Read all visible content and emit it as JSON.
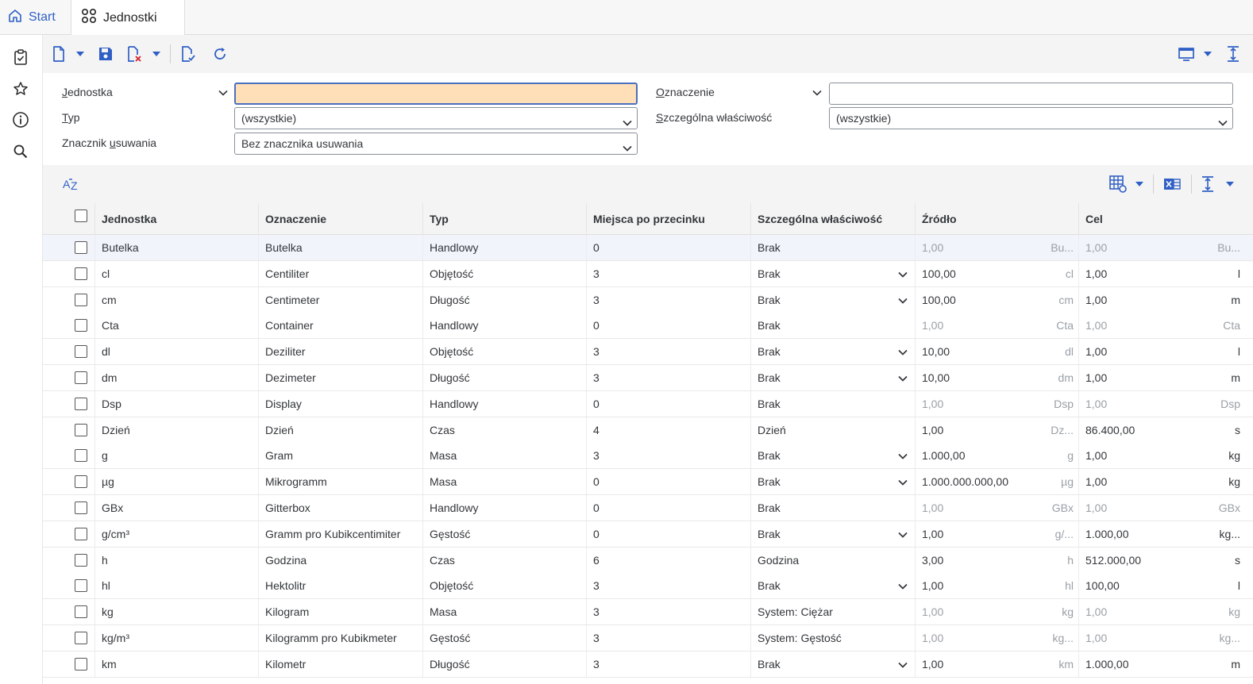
{
  "tabs": [
    {
      "label": "Start",
      "icon": "home-icon"
    },
    {
      "label": "Jednostki",
      "icon": "apps-grid-icon"
    }
  ],
  "rail": [
    "clipboard-check-icon",
    "star-icon",
    "info-icon",
    "search-icon"
  ],
  "filters": {
    "jednostka": {
      "label_pre": "",
      "label_u": "J",
      "label_post": "ednostka",
      "value": ""
    },
    "oznaczenie": {
      "label_pre": "",
      "label_u": "O",
      "label_post": "znaczenie",
      "value": ""
    },
    "typ": {
      "label_pre": "",
      "label_u": "T",
      "label_post": "yp",
      "value": "(wszystkie)"
    },
    "szczegolna": {
      "label_pre": "",
      "label_u": "S",
      "label_post": "zczególna właściwość",
      "value": "(wszystkie)"
    },
    "znacznik": {
      "label_pre": "Znacznik ",
      "label_u": "u",
      "label_post": "suwania",
      "value": "Bez znacznika usuwania"
    }
  },
  "table": {
    "headers": [
      "Jednostka",
      "Oznaczenie",
      "Typ",
      "Miejsca po przecinku",
      "Szczególna właściwość",
      "Źródło",
      "Cel"
    ],
    "rows": [
      {
        "j": "Butelka",
        "o": "Butelka",
        "t": "Handlowy",
        "m": "0",
        "s": "Brak",
        "dd": false,
        "src": "1,00",
        "su": "Bu...",
        "tgt": "1,00",
        "tu": "Bu...",
        "dim": true
      },
      {
        "j": "cl",
        "o": "Centiliter",
        "t": "Objętość",
        "m": "3",
        "s": "Brak",
        "dd": true,
        "src": "100,00",
        "su": "cl",
        "tgt": "1,00",
        "tu": "l",
        "dim": false
      },
      {
        "j": "cm",
        "o": "Centimeter",
        "t": "Długość",
        "m": "3",
        "s": "Brak",
        "dd": true,
        "src": "100,00",
        "su": "cm",
        "tgt": "1,00",
        "tu": "m",
        "dim": false
      },
      {
        "j": "Cta",
        "o": "Container",
        "t": "Handlowy",
        "m": "0",
        "s": "Brak",
        "dd": false,
        "src": "1,00",
        "su": "Cta",
        "tgt": "1,00",
        "tu": "Cta",
        "dim": true
      },
      {
        "j": "dl",
        "o": "Deziliter",
        "t": "Objętość",
        "m": "3",
        "s": "Brak",
        "dd": true,
        "src": "10,00",
        "su": "dl",
        "tgt": "1,00",
        "tu": "l",
        "dim": false
      },
      {
        "j": "dm",
        "o": "Dezimeter",
        "t": "Długość",
        "m": "3",
        "s": "Brak",
        "dd": true,
        "src": "10,00",
        "su": "dm",
        "tgt": "1,00",
        "tu": "m",
        "dim": false
      },
      {
        "j": "Dsp",
        "o": "Display",
        "t": "Handlowy",
        "m": "0",
        "s": "Brak",
        "dd": false,
        "src": "1,00",
        "su": "Dsp",
        "tgt": "1,00",
        "tu": "Dsp",
        "dim": true
      },
      {
        "j": "Dzień",
        "o": "Dzień",
        "t": "Czas",
        "m": "4",
        "s": "Dzień",
        "dd": false,
        "src": "1,00",
        "su": "Dz...",
        "tgt": "86.400,00",
        "tu": "s",
        "dim": false
      },
      {
        "j": "g",
        "o": "Gram",
        "t": "Masa",
        "m": "3",
        "s": "Brak",
        "dd": true,
        "src": "1.000,00",
        "su": "g",
        "tgt": "1,00",
        "tu": "kg",
        "dim": false
      },
      {
        "j": "µg",
        "o": "Mikrogramm",
        "t": "Masa",
        "m": "0",
        "s": "Brak",
        "dd": true,
        "src": "1.000.000.000,00",
        "su": "µg",
        "tgt": "1,00",
        "tu": "kg",
        "dim": false
      },
      {
        "j": "GBx",
        "o": "Gitterbox",
        "t": "Handlowy",
        "m": "0",
        "s": "Brak",
        "dd": false,
        "src": "1,00",
        "su": "GBx",
        "tgt": "1,00",
        "tu": "GBx",
        "dim": true
      },
      {
        "j": "g/cm³",
        "o": "Gramm pro Kubikcentimiter",
        "t": "Gęstość",
        "m": "0",
        "s": "Brak",
        "dd": true,
        "src": "1,00",
        "su": "g/...",
        "tgt": "1.000,00",
        "tu": "kg...",
        "dim": false
      },
      {
        "j": "h",
        "o": "Godzina",
        "t": "Czas",
        "m": "6",
        "s": "Godzina",
        "dd": false,
        "src": "3,00",
        "su": "h",
        "tgt": "512.000,00",
        "tu": "s",
        "dim": false
      },
      {
        "j": "hl",
        "o": "Hektolitr",
        "t": "Objętość",
        "m": "3",
        "s": "Brak",
        "dd": true,
        "src": "1,00",
        "su": "hl",
        "tgt": "100,00",
        "tu": "l",
        "dim": false
      },
      {
        "j": "kg",
        "o": "Kilogram",
        "t": "Masa",
        "m": "3",
        "s": "System: Ciężar",
        "dd": false,
        "src": "1,00",
        "su": "kg",
        "tgt": "1,00",
        "tu": "kg",
        "dim": true
      },
      {
        "j": "kg/m³",
        "o": "Kilogramm pro Kubikmeter",
        "t": "Gęstość",
        "m": "3",
        "s": "System: Gęstość",
        "dd": false,
        "src": "1,00",
        "su": "kg...",
        "tgt": "1,00",
        "tu": "kg...",
        "dim": true
      },
      {
        "j": "km",
        "o": "Kilometr",
        "t": "Długość",
        "m": "3",
        "s": "Brak",
        "dd": true,
        "src": "1,00",
        "su": "km",
        "tgt": "1.000,00",
        "tu": "m",
        "dim": false
      }
    ]
  },
  "colors": {
    "accent": "#2f5fc5",
    "active_field": "#ffdfb8",
    "active_border": "#4b6fbf",
    "dim_text": "#9aa0a6"
  }
}
